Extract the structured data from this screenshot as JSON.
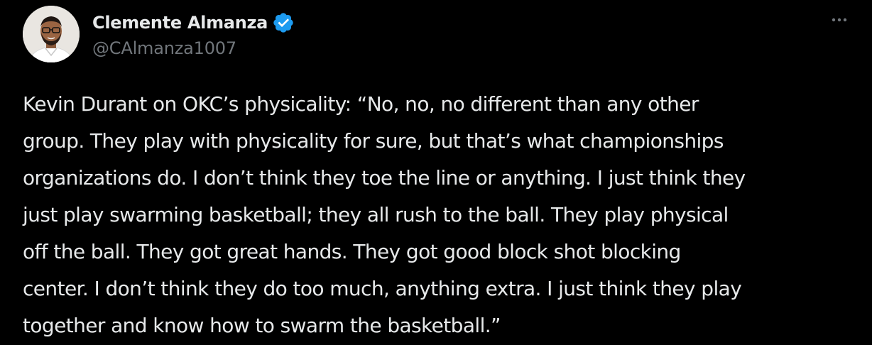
{
  "tweet": {
    "author": {
      "display_name": "Clemente Almanza",
      "handle": "@CAlmanza1007",
      "verified": true,
      "avatar_icon": "profile-photo"
    },
    "more_icon": "more-horizontal-icon",
    "text_lines": [
      "Kevin Durant on OKC’s physicality: “No, no, no different than any other",
      "group. They play with physicality for sure, but that’s what championships",
      "organizations do. I don’t think they toe the line or anything. I just think they",
      "just play swarming basketball; they all rush to the ball. They play physical",
      "off the ball. They got great hands. They got good block shot blocking",
      "center. I don’t think they do too much, anything extra. I just think they play",
      "together and know how to swarm the basketball.”"
    ]
  },
  "colors": {
    "background": "#000000",
    "primary_text": "#e7e9ea",
    "secondary_text": "#71767b",
    "verified_badge": "#1d9bf0"
  }
}
